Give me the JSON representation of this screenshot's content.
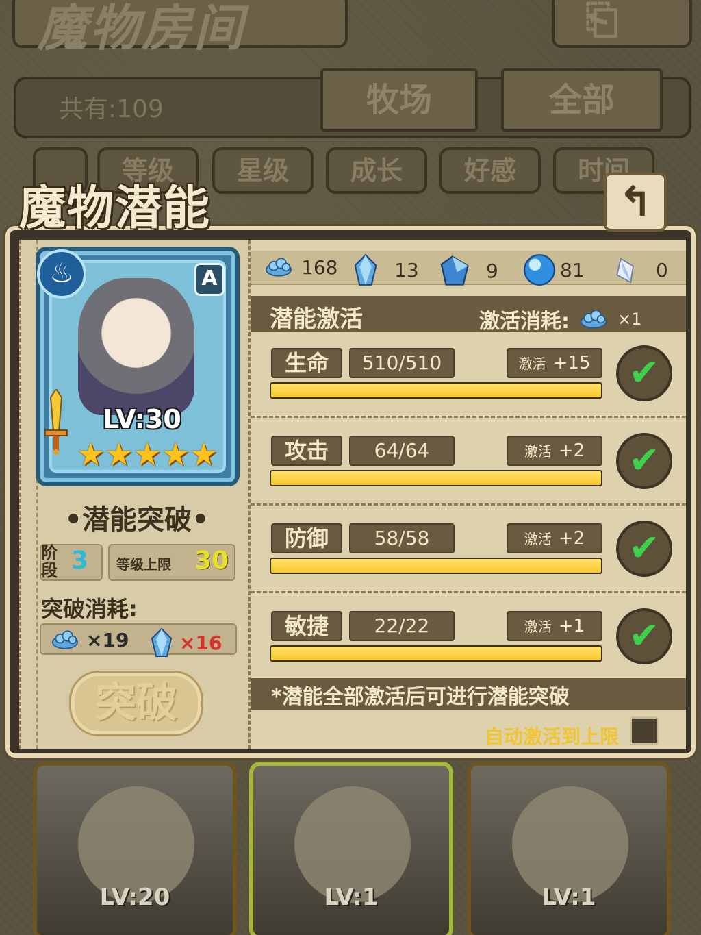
{
  "background": {
    "title": "魔物房间",
    "total_count": "共有:109",
    "tabs": [
      "牧场",
      "全部"
    ],
    "sort_buttons": [
      "等级",
      "星级",
      "成长",
      "好感",
      "时间"
    ],
    "cards": [
      {
        "level": "LV:20"
      },
      {
        "level": "LV:1"
      },
      {
        "level": "LV:1"
      }
    ]
  },
  "panel": {
    "title": "魔物潜能",
    "back_icon": "back-arrow-icon"
  },
  "monster": {
    "element_icon": "water-element-icon",
    "rank": "A",
    "level": "LV:30",
    "stars": 5
  },
  "breakthrough": {
    "title": "•潜能突破•",
    "stage_label": "阶段",
    "stage_value": "3",
    "level_cap_label": "等级上限",
    "level_cap_value": "30",
    "cost_title": "突破消耗:",
    "costs": [
      {
        "icon": "blue-flower-icon",
        "amount": "×19",
        "color": "#2b2b2b"
      },
      {
        "icon": "blue-crystal-icon",
        "amount": "×16",
        "color": "#d8302a"
      }
    ],
    "button_label": "突破"
  },
  "resources": [
    {
      "icon": "blue-flower-icon",
      "value": "168"
    },
    {
      "icon": "blue-crystal-icon",
      "value": "13"
    },
    {
      "icon": "blue-gem-icon",
      "value": "9"
    },
    {
      "icon": "blue-orb-icon",
      "value": "81"
    },
    {
      "icon": "white-crystal-icon",
      "value": "0"
    }
  ],
  "potential": {
    "section_title": "潜能激活",
    "cost_label": "激活消耗:",
    "cost_amount": "×1",
    "stats": [
      {
        "name": "生命",
        "value": "510/510",
        "activate_label": "激活",
        "bonus": "+15",
        "progress": 1.0
      },
      {
        "name": "攻击",
        "value": "64/64",
        "activate_label": "激活",
        "bonus": "+2",
        "progress": 1.0
      },
      {
        "name": "防御",
        "value": "58/58",
        "activate_label": "激活",
        "bonus": "+2",
        "progress": 1.0
      },
      {
        "name": "敏捷",
        "value": "22/22",
        "activate_label": "激活",
        "bonus": "+1",
        "progress": 1.0
      }
    ],
    "note": "*潜能全部激活后可进行潜能突破",
    "auto_label": "自动激活到上限"
  },
  "colors": {
    "progress_fill": "#f5c82a",
    "check_green": "#3fd04a",
    "cap_yellow": "#e8e02a",
    "stage_cyan": "#2fb8d8"
  }
}
